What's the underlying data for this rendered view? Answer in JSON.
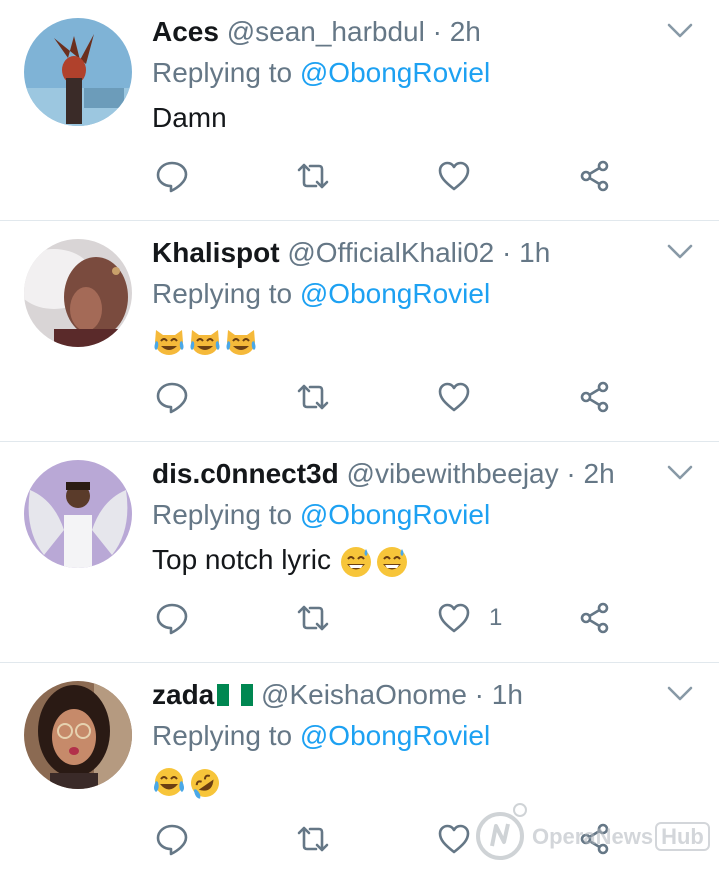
{
  "tweets": [
    {
      "name": "Aces",
      "handle": "@sean_harbdul",
      "separator": "·",
      "time": "2h",
      "replying_prefix": "Replying to",
      "replying_to": "@ObongRoviel",
      "text": "Damn",
      "emoji": [],
      "like_count": ""
    },
    {
      "name": "Khalispot",
      "handle": "@OfficialKhali02",
      "separator": "·",
      "time": "1h",
      "replying_prefix": "Replying to",
      "replying_to": "@ObongRoviel",
      "text": "",
      "emoji": [
        "cat-tears-of-joy",
        "cat-tears-of-joy",
        "cat-tears-of-joy"
      ],
      "like_count": ""
    },
    {
      "name": "dis.c0nnect3d",
      "handle": "@vibewithbeejay",
      "separator": "·",
      "time": "2h",
      "replying_prefix": "Replying to",
      "replying_to": "@ObongRoviel",
      "text": "Top notch lyric",
      "emoji": [
        "grinning-sweat",
        "grinning-sweat"
      ],
      "like_count": "1"
    },
    {
      "name": "zada",
      "name_flag": "nigeria-flag",
      "handle": "@KeishaOnome",
      "separator": "·",
      "time": "1h",
      "replying_prefix": "Replying to",
      "replying_to": "@ObongRoviel",
      "text": "",
      "emoji": [
        "tears-of-joy",
        "rolling-on-floor-laughing"
      ],
      "like_count": ""
    }
  ],
  "icons": {
    "reply": "reply-icon",
    "retweet": "retweet-icon",
    "like": "heart-icon",
    "share": "share-icon",
    "more": "chevron-down-icon"
  },
  "colors": {
    "link": "#1da1f2",
    "secondary": "#657786",
    "divider": "#e1e8ed"
  },
  "watermark": {
    "text": "OperaNews",
    "badge": "Hub"
  }
}
